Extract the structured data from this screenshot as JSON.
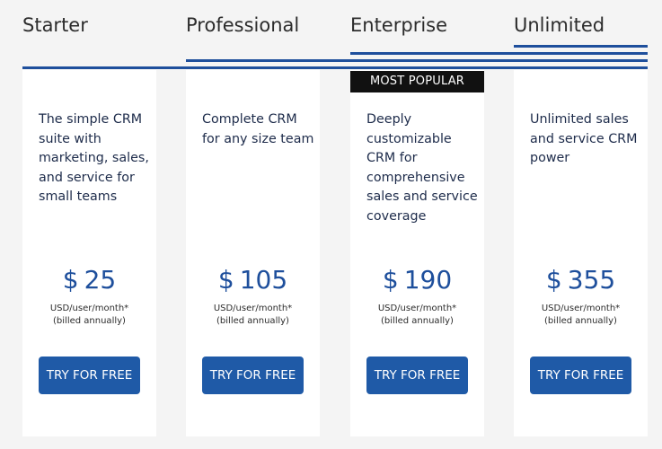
{
  "plans": [
    {
      "name": "Starter",
      "description": "The simple CRM suite with marketing, sales, and service for small teams",
      "currency": "$",
      "price": "25",
      "unit": "USD/user/month*",
      "billing": "(billed annually)",
      "cta": "TRY FOR FREE"
    },
    {
      "name": "Professional",
      "description": "Complete CRM for any size team",
      "currency": "$",
      "price": "105",
      "unit": "USD/user/month*",
      "billing": "(billed annually)",
      "cta": "TRY FOR FREE"
    },
    {
      "name": "Enterprise",
      "description": "Deeply customizable CRM for comprehensive sales and service coverage",
      "currency": "$",
      "price": "190",
      "unit": "USD/user/month*",
      "billing": "(billed annually)",
      "cta": "TRY FOR FREE",
      "badge": "MOST POPULAR"
    },
    {
      "name": "Unlimited",
      "description": "Unlimited sales and service CRM power",
      "currency": "$",
      "price": "355",
      "unit": "USD/user/month*",
      "billing": "(billed annually)",
      "cta": "TRY FOR FREE"
    }
  ],
  "colors": {
    "accent": "#1e4f9c",
    "button": "#1f5aa7",
    "badge": "#111111",
    "background": "#f4f4f4",
    "card": "#ffffff"
  }
}
